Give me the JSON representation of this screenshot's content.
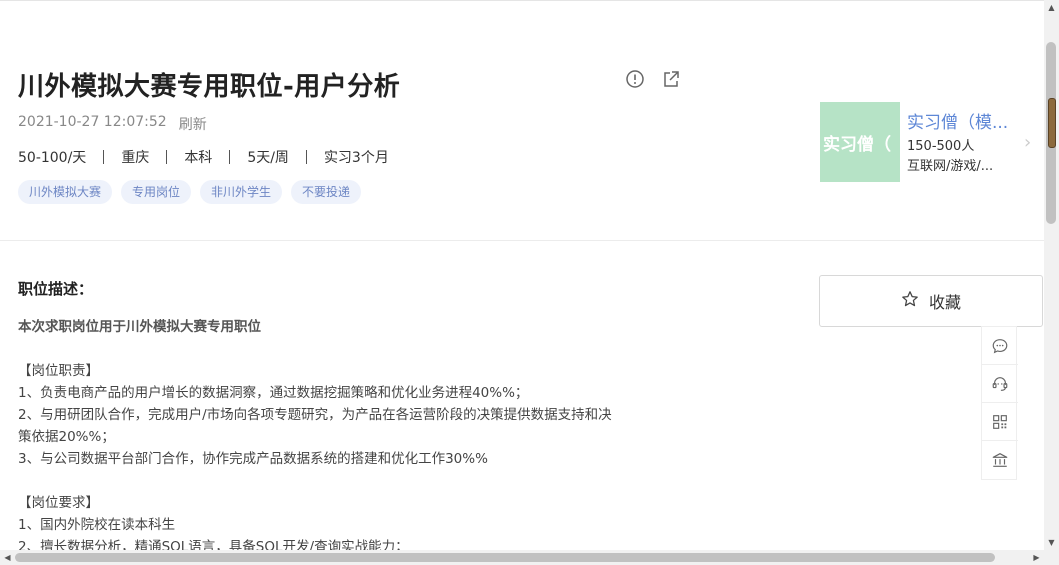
{
  "job": {
    "title": "川外模拟大赛专用职位-用户分析",
    "datetime": "2021-10-27 12:07:52",
    "refresh_label": "刷新",
    "requirements": [
      "50-100/天",
      "重庆",
      "本科",
      "5天/周",
      "实习3个月"
    ],
    "tags": [
      "川外模拟大赛",
      "专用岗位",
      "非川外学生",
      "不要投递"
    ]
  },
  "header_icons": [
    "report-icon",
    "share-icon"
  ],
  "company": {
    "logo_text": "实习僧（",
    "name": "实习僧（模...",
    "size": "150-500人",
    "industry": "互联网/游戏/..."
  },
  "description": {
    "heading": "职位描述：",
    "intro": "本次求职岗位用于川外模拟大赛专用职位",
    "duties_heading": "【岗位职责】",
    "duties": [
      "1、负责电商产品的用户增长的数据洞察，通过数据挖掘策略和优化业务进程40%%；",
      "2、与用研团队合作，完成用户/市场向各项专题研究，为产品在各运营阶段的决策提供数据支持和决",
      "策依据20%%；",
      "3、与公司数据平台部门合作，协作完成产品数据系统的搭建和优化工作30%%"
    ],
    "requirements_heading": "【岗位要求】",
    "requirements": [
      "1、国内外院校在读本科生",
      "2、擅长数据分析，精通SQL语言，具备SQL开发/查询实战能力；"
    ]
  },
  "actions": {
    "collect_label": "收藏"
  },
  "side_tools": [
    "chat-icon",
    "customer-service-icon",
    "qr-code-icon",
    "institution-icon"
  ],
  "colors": {
    "tag_bg": "#eef2fb",
    "tag_text": "#6d86c4",
    "company_name": "#5e87d6",
    "logo_bg": "#b6e3c6"
  }
}
